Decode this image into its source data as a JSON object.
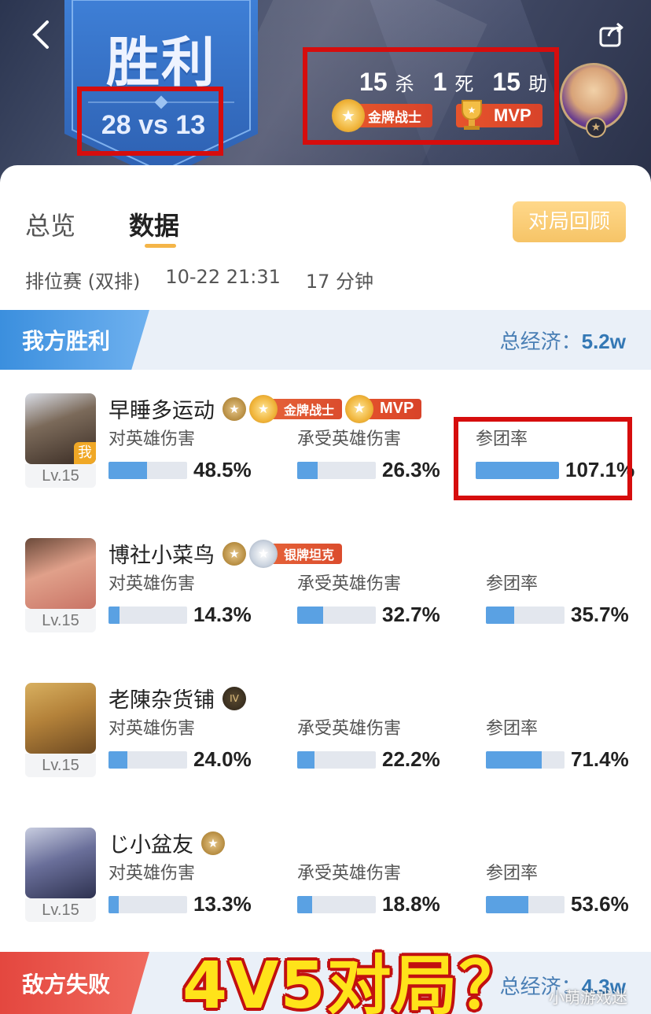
{
  "header": {
    "result_title": "胜利",
    "score": "28 vs 13",
    "kills": "15",
    "kills_label": "杀",
    "deaths": "1",
    "deaths_label": "死",
    "assists": "15",
    "assists_label": "助",
    "badge_gold": "金牌战士",
    "badge_mvp": "MVP",
    "back_icon": "back-arrow-icon",
    "share_icon": "share-icon"
  },
  "tabs": [
    {
      "label": "总览",
      "active": false
    },
    {
      "label": "数据",
      "active": true
    }
  ],
  "review_button": "对局回顾",
  "match_info": {
    "mode": "排位赛 (双排)",
    "time": "10-22 21:31",
    "duration": "17 分钟"
  },
  "my_team": {
    "label": "我方胜利",
    "economy_label": "总经济：",
    "economy_value": "5.2w"
  },
  "enemy_team": {
    "label": "敌方失败",
    "economy_label": "总经济：",
    "economy_value": "4.3w"
  },
  "stat_labels": {
    "damage_dealt": "对英雄伤害",
    "damage_taken": "承受英雄伤害",
    "participation": "参团率"
  },
  "players": [
    {
      "name": "早睡多运动",
      "level": "Lv.15",
      "me_tag": "我",
      "badges": [
        "金牌战士",
        "MVP"
      ],
      "damage_dealt": "48.5%",
      "damage_taken": "26.3%",
      "participation": "107.1%",
      "fill": [
        0.485,
        0.263,
        1.0
      ]
    },
    {
      "name": "博社小菜鸟",
      "level": "Lv.15",
      "badges": [
        "银牌坦克"
      ],
      "damage_dealt": "14.3%",
      "damage_taken": "32.7%",
      "participation": "35.7%",
      "fill": [
        0.143,
        0.327,
        0.357
      ]
    },
    {
      "name": "老陳杂货铺",
      "level": "Lv.15",
      "rank_mark": "IV",
      "badges": [],
      "damage_dealt": "24.0%",
      "damage_taken": "22.2%",
      "participation": "71.4%",
      "fill": [
        0.24,
        0.222,
        0.714
      ]
    },
    {
      "name": "じ小盆友",
      "level": "Lv.15",
      "badges": [],
      "damage_dealt": "13.3%",
      "damage_taken": "18.8%",
      "participation": "53.6%",
      "fill": [
        0.133,
        0.188,
        0.536
      ]
    }
  ],
  "overlay_caption": "4V5对局？",
  "watermark": "小萌游戏迷",
  "colors": {
    "accent_blue": "#5aa1e3",
    "win_blue": "#3b8fde",
    "lose_red": "#e4473f",
    "highlight_red": "#d60d0d",
    "review_gold": "#f6c467"
  }
}
